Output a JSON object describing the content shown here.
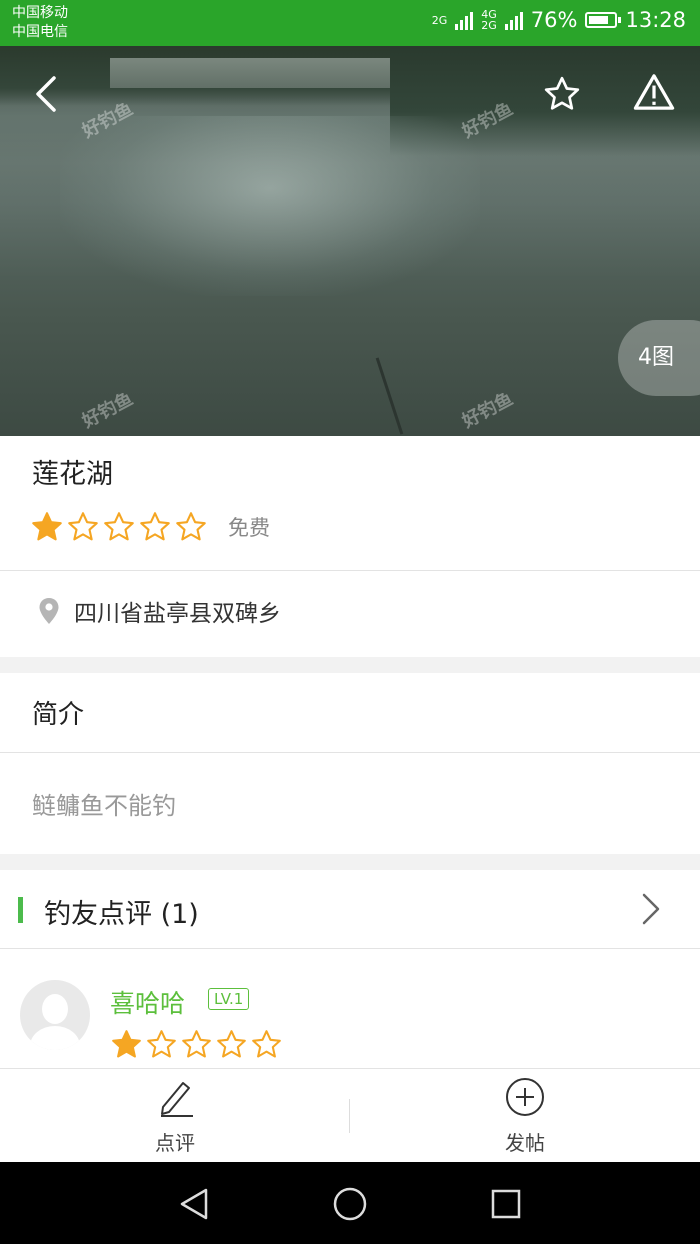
{
  "status_bar": {
    "carrier_1": "中国移动",
    "carrier_2": "中国电信",
    "network_1": "2G",
    "network_2": "4G",
    "network_3": "2G",
    "battery_percent": "76%",
    "battery_level": 0.76,
    "time": "13:28",
    "bg_color": "#2aa52a"
  },
  "hero": {
    "photo_count": "4图",
    "watermark": "好钓鱼",
    "icons": [
      "back-icon",
      "star-outline-icon",
      "warning-icon"
    ]
  },
  "spot": {
    "name": "莲花湖",
    "rating": 1,
    "rating_max": 5,
    "price": "免费",
    "address": "四川省盐亭县双碑乡",
    "star_color": "#f5a623"
  },
  "intro": {
    "title": "简介",
    "text": "鲢鳙鱼不能钓"
  },
  "reviews": {
    "title": "钓友点评 (1)",
    "accent_color": "#4cbb4c",
    "items": [
      {
        "name": "喜哈哈",
        "level": "LV.1",
        "rating": 1
      }
    ]
  },
  "action_bar": {
    "review_label": "点评",
    "post_label": "发帖"
  }
}
